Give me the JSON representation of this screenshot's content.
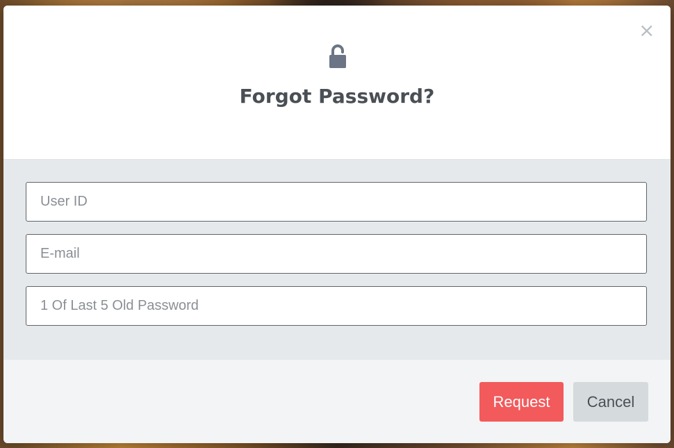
{
  "dialog": {
    "title": "Forgot Password?",
    "close_label": "×",
    "icon": "unlock-icon"
  },
  "form": {
    "user_id": {
      "placeholder": "User ID",
      "value": ""
    },
    "email": {
      "placeholder": "E-mail",
      "value": ""
    },
    "old_password": {
      "placeholder": "1 Of Last 5 Old Password",
      "value": ""
    }
  },
  "footer": {
    "request_label": "Request",
    "cancel_label": "Cancel"
  },
  "colors": {
    "primary": "#f25a5c",
    "icon": "#6b7585",
    "title": "#4a4f55",
    "body_bg": "#e6e9eb",
    "footer_bg": "#f2f4f5"
  }
}
